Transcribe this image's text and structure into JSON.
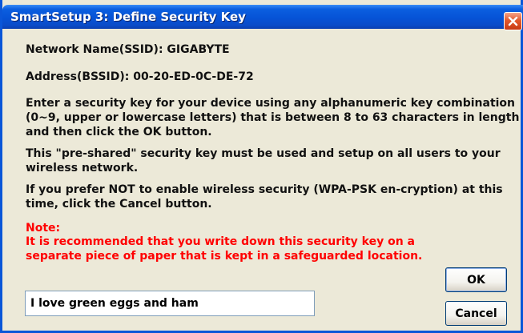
{
  "window": {
    "title": "SmartSetup 3: Define Security Key",
    "close_icon": "close-icon"
  },
  "content": {
    "network_name": "Network Name(SSID):  GIGABYTE",
    "address": "Address(BSSID):  00-20-ED-0C-DE-72",
    "instructions": [
      "Enter a security key for your device using any alphanumeric key combination",
      "(0~9, upper or lowercase letters) that is between 8 to 63 characters in length",
      "and then click the OK button."
    ],
    "preshared": [
      "This \"pre-shared\" security key must be used and setup on all users to your",
      "wireless network."
    ],
    "prefer_not": [
      "If you prefer NOT to enable wireless security (WPA-PSK en-cryption) at this",
      "time, click the Cancel button."
    ],
    "note_label": "Note:",
    "note": [
      "It is recommended that you write down this security key on a",
      "separate piece of paper that is kept in a safeguarded location."
    ]
  },
  "security_key_input": {
    "value": "I love green eggs and ham"
  },
  "buttons": {
    "ok": "OK",
    "cancel": "Cancel"
  },
  "colors": {
    "titlebar": "#0653d6",
    "dialog_background": "#ece9d8",
    "note_text": "#ff0000",
    "close_button": "#e3592c"
  }
}
